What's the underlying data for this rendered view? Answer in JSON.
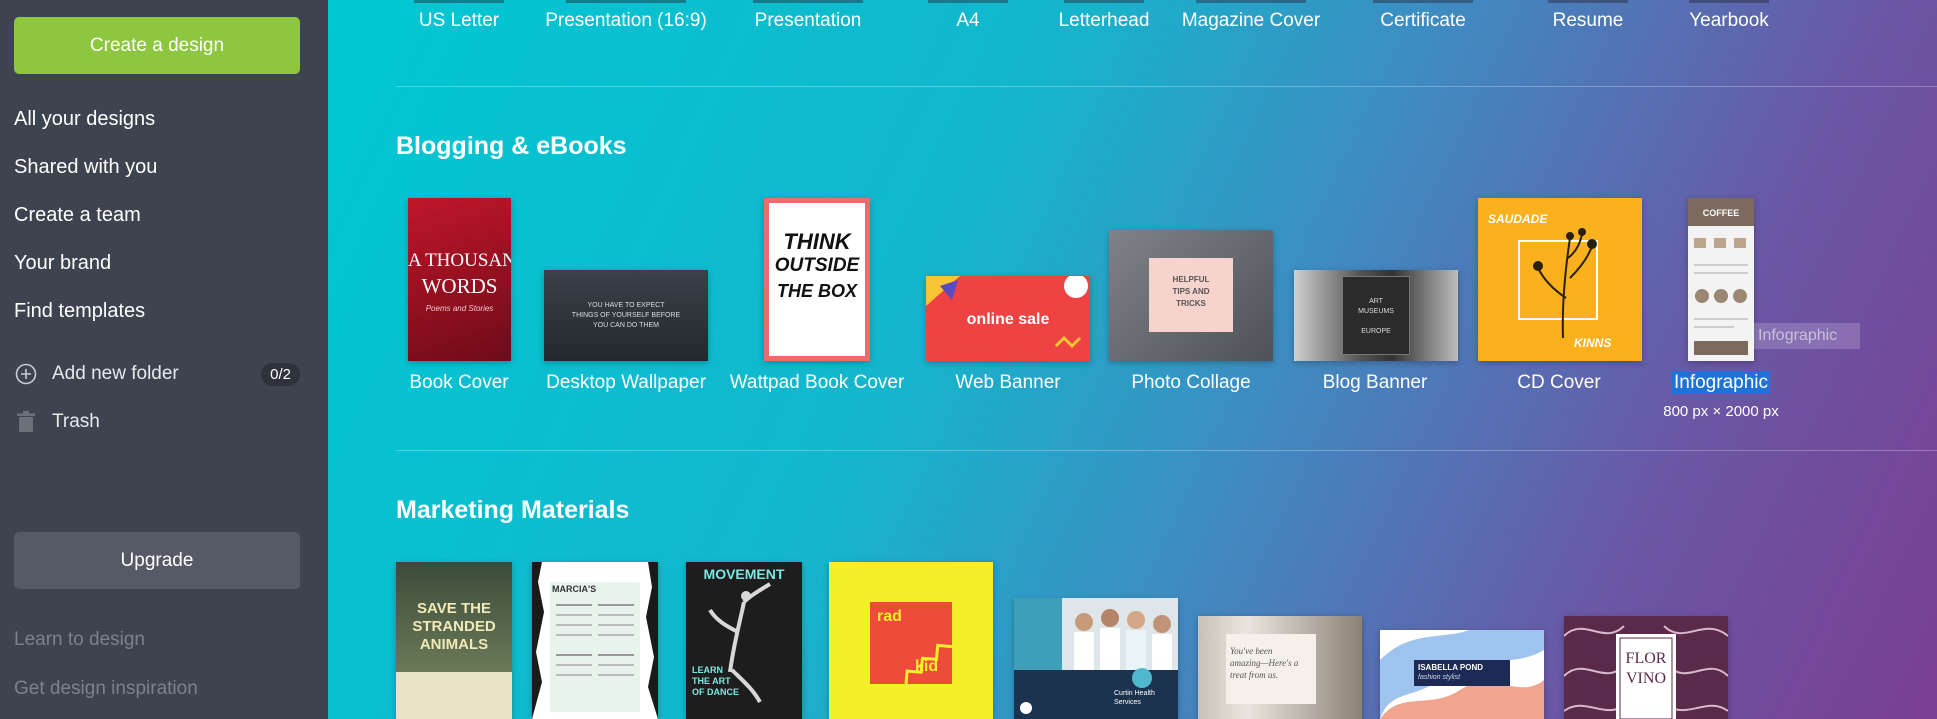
{
  "sidebar": {
    "create_label": "Create a design",
    "nav": [
      "All your designs",
      "Shared with you",
      "Create a team",
      "Your brand",
      "Find templates"
    ],
    "add_folder_label": "Add new folder",
    "folder_count": "0/2",
    "trash_label": "Trash",
    "upgrade_label": "Upgrade",
    "learn_label": "Learn to design",
    "inspiration_label": "Get design inspiration"
  },
  "top_row": [
    "US Letter",
    "Presentation (16:9)",
    "Presentation",
    "A4",
    "Letterhead",
    "Magazine Cover",
    "Certificate",
    "Resume",
    "Yearbook"
  ],
  "blogging": {
    "title": "Blogging & eBooks",
    "items": [
      {
        "label": "Book Cover",
        "thumb": [
          "A THOUSAND",
          "WORDS",
          "Poems and Stories"
        ]
      },
      {
        "label": "Desktop Wallpaper",
        "thumb": [
          "YOU HAVE TO EXPECT",
          "THINGS OF YOURSELF BEFORE",
          "YOU CAN DO THEM"
        ]
      },
      {
        "label": "Wattpad Book Cover",
        "thumb": [
          "THINK",
          "OUTSIDE",
          "THE BOX"
        ]
      },
      {
        "label": "Web Banner",
        "thumb": [
          "online sale"
        ]
      },
      {
        "label": "Photo Collage",
        "thumb": [
          "HELPFUL",
          "TIPS AND",
          "TRICKS"
        ]
      },
      {
        "label": "Blog Banner",
        "thumb": [
          "ART",
          "MUSEUMS",
          "EUROPE"
        ]
      },
      {
        "label": "CD Cover",
        "thumb": [
          "SAUDADE",
          "KINNS"
        ]
      },
      {
        "label": "Infographic",
        "size": "800 px × 2000 px",
        "tooltip": "Infographic",
        "thumb": [
          "COFFEE"
        ]
      }
    ]
  },
  "marketing": {
    "title": "Marketing Materials",
    "thumbs": {
      "save": [
        "SAVE THE",
        "STRANDED",
        "ANIMALS"
      ],
      "menu": [
        "MARCIA'S"
      ],
      "movement": [
        "MOVEMENT",
        "LEARN",
        "THE ART",
        "OF DANCE"
      ],
      "rad": [
        "rad",
        "kid"
      ],
      "health": [
        "Curtin Health",
        "Services"
      ],
      "amazing": [
        "You've been",
        "amazing—Here's a",
        "treat from us."
      ],
      "isabella": [
        "ISABELLA POND",
        "fashion stylist"
      ],
      "flor": [
        "FLOR",
        "VINO"
      ]
    }
  },
  "colors": {
    "sidebar_bg": "#3e4350",
    "create_green": "#8dc63f",
    "selection_blue": "#1f73d6"
  }
}
